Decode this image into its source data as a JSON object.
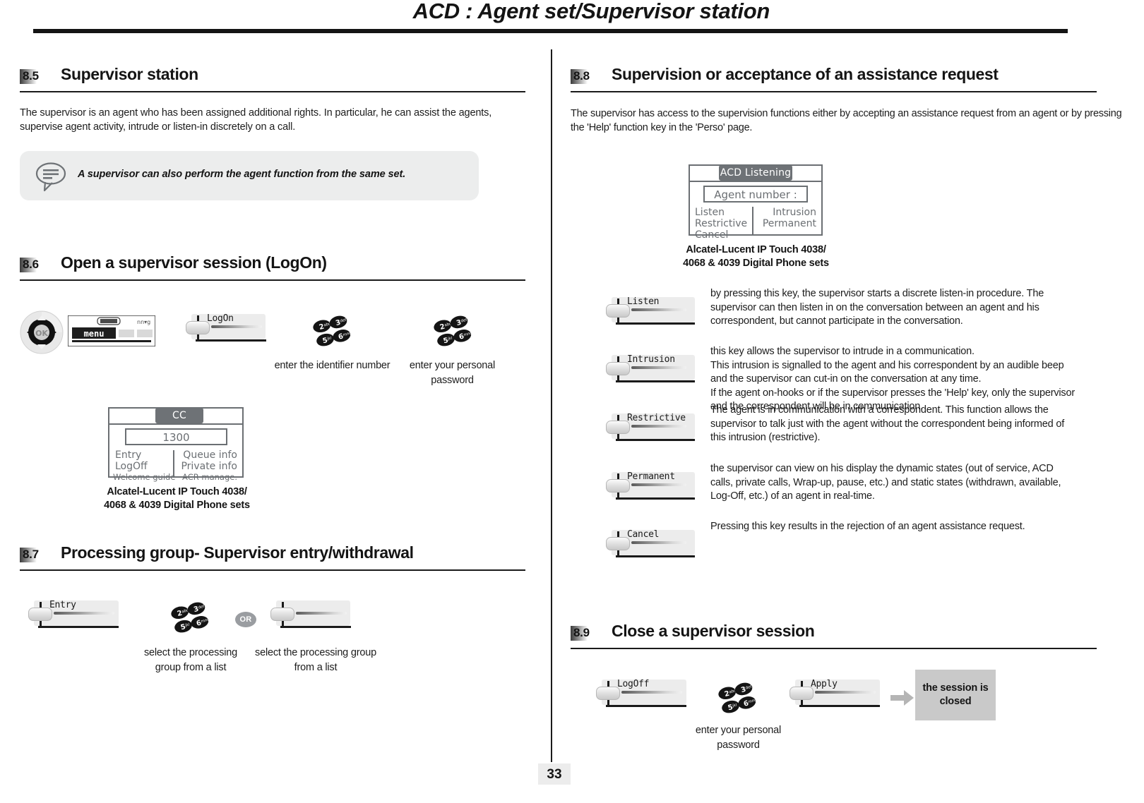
{
  "header": {
    "title": "ACD : Agent set/Supervisor station"
  },
  "page_number": "33",
  "left_column": {
    "sections": [
      {
        "number": "8.5",
        "title": "Supervisor station",
        "paragraph": "The supervisor is an agent who has been assigned additional rights. In particular, he can assist the agents, supervise agent activity, intrude or listen-in discretely on a call.",
        "note": {
          "icon": "speech-bubble-icon",
          "text": "A supervisor can also perform the agent function from the same set."
        }
      },
      {
        "number": "8.6",
        "title": "Open a supervisor session (LogOn)",
        "steps": {
          "navigator_icon": "navigator-ok-icon",
          "menu_display_label": "menu",
          "softkey_logon": "LogOn",
          "keypad_1": "keypad-icon",
          "caption_1": "enter the identifier number",
          "keypad_2": "keypad-icon",
          "caption_2": "enter your personal password"
        },
        "phone_screen": {
          "tab": "CC",
          "field": "1300",
          "left_items": [
            "Entry",
            "LogOff",
            "Welcome guide"
          ],
          "right_items": [
            "Queue info",
            "Private info",
            "ACR manage."
          ]
        },
        "phone_caption_line1": "Alcatel-Lucent IP Touch 4038/",
        "phone_caption_line2": "4068 & 4039 Digital Phone sets"
      },
      {
        "number": "8.7",
        "title": "Processing group- Supervisor entry/withdrawal",
        "steps": {
          "softkey_entry": "Entry",
          "keypad": "keypad-icon",
          "or_label": "OR",
          "softkey_blank": "",
          "caption_keypad": "select the processing group from a list",
          "caption_list": "select the processing group from a list"
        }
      }
    ]
  },
  "right_column": {
    "sections": [
      {
        "number": "8.8",
        "title": "Supervision or acceptance of an assistance request",
        "paragraph": "The supervisor has access to the supervision functions either by accepting an assistance request from an agent or by pressing the 'Help' function key in the 'Perso' page.",
        "phone_screen": {
          "tab": "ACD Listening",
          "field": "Agent number :",
          "left_items": [
            "Listen",
            "Restrictive",
            "Cancel"
          ],
          "right_items": [
            "Intrusion",
            "Permanent"
          ]
        },
        "phone_caption_line1": "Alcatel-Lucent IP Touch 4038/",
        "phone_caption_line2": "4068 & 4039 Digital Phone sets",
        "keys": [
          {
            "label": "Listen",
            "description": "by pressing this key, the supervisor starts a discrete listen-in procedure. The supervisor can then listen in on the conversation between an agent and his correspondent, but cannot participate in the conversation."
          },
          {
            "label": "Intrusion",
            "description": "this key allows the supervisor to intrude in a communication.\nThis intrusion is signalled to the agent and his correspondent by an audible beep and the supervisor can cut-in on the conversation at any time.\nIf the agent on-hooks or if the supervisor presses the 'Help' key, only the supervisor and the correspondent will be in communication."
          },
          {
            "label": "Restrictive",
            "description": "The agent is in communication with a correspondent. This function allows the supervisor to talk just with the agent without the correspondent being informed of this intrusion (restrictive)."
          },
          {
            "label": "Permanent",
            "description": "the supervisor can view on his display the dynamic states (out of service, ACD calls, private calls, Wrap-up, pause, etc.) and static states (withdrawn, available, Log-Off, etc.) of an agent in real-time."
          },
          {
            "label": "Cancel",
            "description": "Pressing this key results in the rejection of an agent assistance request."
          }
        ]
      },
      {
        "number": "8.9",
        "title": "Close a supervisor session",
        "steps": {
          "softkey_logoff": "LogOff",
          "keypad": "keypad-icon",
          "caption_keypad": "enter your personal password",
          "softkey_apply": "Apply",
          "arrow_icon": "arrow-right-icon",
          "result_line1": "the session is",
          "result_line2": "closed"
        }
      }
    ]
  },
  "keypad_keys": [
    "2abc",
    "3def",
    "5jkl",
    "6mno"
  ],
  "colors": {
    "rule": "#141414",
    "screen_border": "#6b6f73",
    "screen_tab_bg": "#6e7276",
    "note_bg": "#eceded",
    "softkey_bg": "#ececec",
    "result_bg": "#c9c9c9",
    "or_bg": "#9a9da1"
  }
}
